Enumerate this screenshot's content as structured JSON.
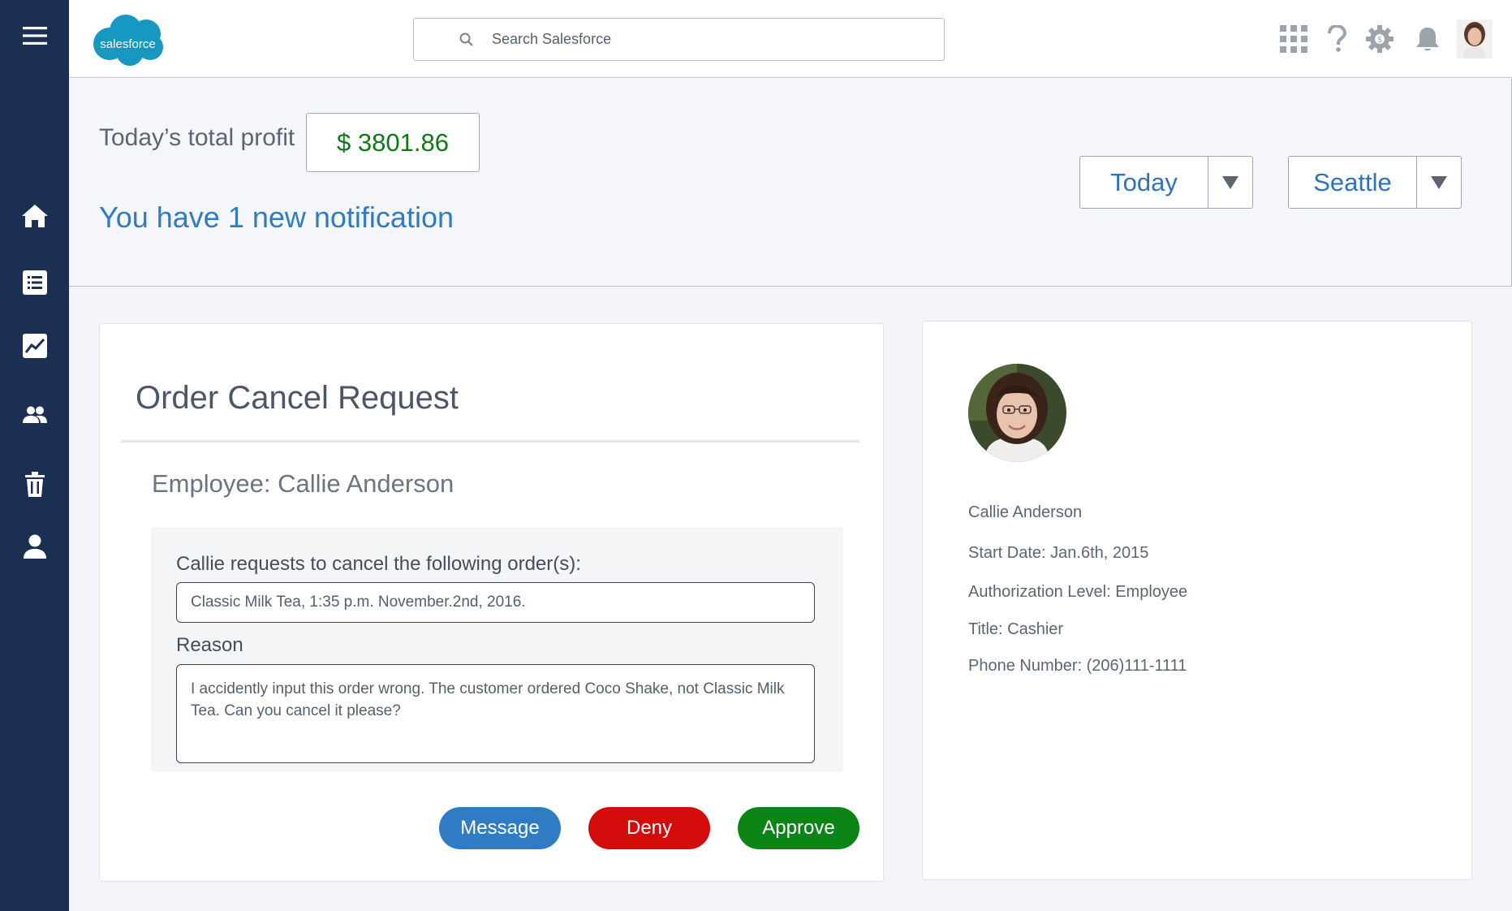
{
  "topbar": {
    "logo_text": "salesforce",
    "search_placeholder": "Search Salesforce"
  },
  "banner": {
    "profit_label": "Today’s total profit",
    "profit_value": "$ 3801.86",
    "notification": "You have 1 new notification",
    "period_value": "Today",
    "location_value": "Seattle"
  },
  "sidebar": {
    "items": [
      "menu-icon",
      "home-icon",
      "list-icon",
      "chart-icon",
      "people-icon",
      "trash-icon",
      "user-icon"
    ]
  },
  "request": {
    "title": "Order Cancel Request",
    "employee": "Employee: Callie Anderson",
    "orders_label": "Callie requests to cancel the following order(s):",
    "order": "Classic Milk Tea, 1:35 p.m. November.2nd, 2016.",
    "reason_label": "Reason",
    "reason": "I accidently input this order wrong. The customer ordered Coco Shake, not Classic Milk Tea. Can you cancel it please?",
    "buttons": {
      "message": "Message",
      "deny": "Deny",
      "approve": "Approve"
    }
  },
  "profile": {
    "name": "Callie Anderson",
    "start_date": "Start Date: Jan.6th, 2015",
    "authorization": "Authorization Level: Employee",
    "title": "Title: Cashier",
    "phone": "Phone Number: (206)111-1111"
  },
  "colors": {
    "sidebar": "#1b2f53",
    "accent_blue": "#2f7bc4",
    "profit_green": "#0d7a17",
    "message_button": "#2f7cc5",
    "deny_button": "#d40b0b",
    "approve_button": "#0d8416"
  }
}
